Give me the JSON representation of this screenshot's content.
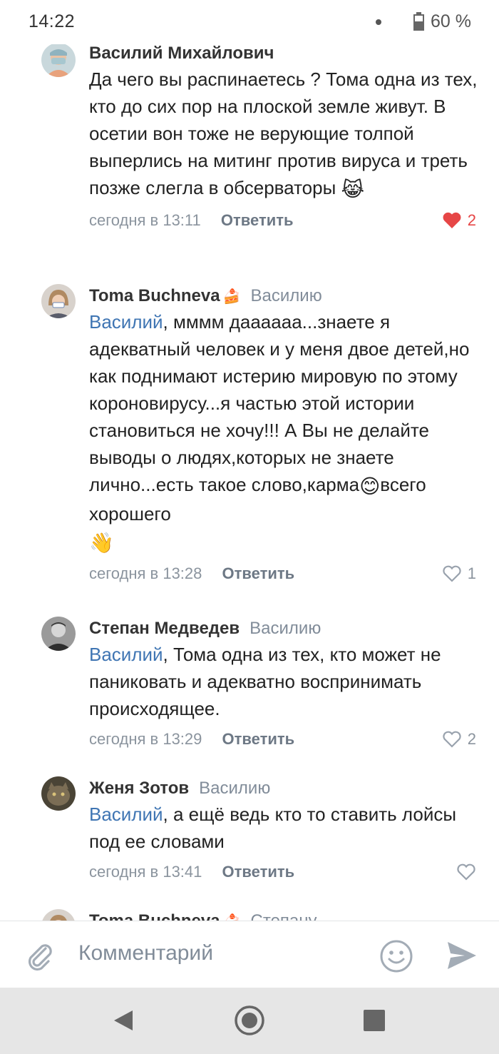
{
  "status_bar": {
    "time": "14:22",
    "battery": "60 %",
    "battery_level": 0.6
  },
  "comments": [
    {
      "author": "Василий Михайлович",
      "reply_to": "",
      "mention": "",
      "text": "Да чего вы распинаетесь ? Тома одна из тех, кто до сих пор на плоской земле живут. В осетии вон тоже не верующие толпой выперлись на митинг против вируса и треть позже слегла в обсерваторы ",
      "emoji": "😹",
      "date": "сегодня в 13:11",
      "reply_label": "Ответить",
      "likes": "2",
      "liked": true
    },
    {
      "author": "Tomа Buchneva",
      "author_emoji": "🍰",
      "reply_to": "Василию",
      "mention": "Василий",
      "text": ", мммм дааааaa...знаете я адекватный человек и у меня двое детей,но как поднимают истерию мировую по этому короновирусу...я частью этой истории становиться не хочу!!! А Вы не делайте выводы о людях,которых не знаете лично...есть такое слово,карма",
      "emoji_mid": "😊",
      "text_after": "всего хорошего",
      "emoji": "👋",
      "date": "сегодня в 13:28",
      "reply_label": "Ответить",
      "likes": "1",
      "liked": false
    },
    {
      "author": "Степан Медведев",
      "reply_to": "Василию",
      "mention": "Василий",
      "text": ", Тома одна из тех, кто может не паниковать и адекватно воспринимать происходящее.",
      "date": "сегодня в 13:29",
      "reply_label": "Ответить",
      "likes": "2",
      "liked": false
    },
    {
      "author": "Женя Зотов",
      "reply_to": "Василию",
      "mention": "Василий",
      "text": ", а ещё ведь кто то ставить лойсы под ее словами",
      "date": "сегодня в 13:41",
      "reply_label": "Ответить",
      "likes": "",
      "liked": false
    },
    {
      "author": "Tomа Buchneva",
      "author_emoji": "🍰",
      "reply_to": "Степану"
    }
  ],
  "composer": {
    "placeholder": "Комментарий"
  },
  "icons": {
    "attach": "paperclip-icon",
    "smile": "smile-icon",
    "send": "send-icon",
    "like": "heart-icon",
    "nav_back": "back-triangle-icon",
    "nav_home": "home-circle-icon",
    "nav_recent": "recent-square-icon"
  },
  "colors": {
    "mention": "#3f75b3",
    "liked": "#e64646",
    "muted": "#818c99"
  }
}
